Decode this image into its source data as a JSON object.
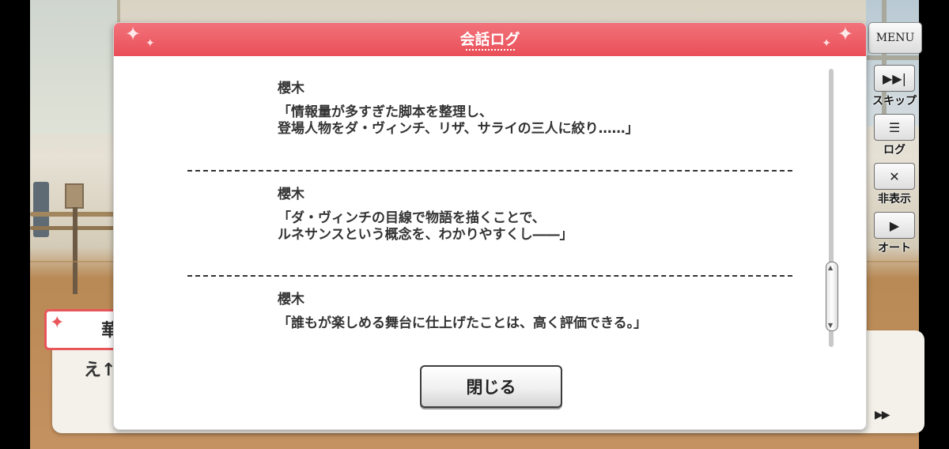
{
  "dialog": {
    "title": "会話ログ",
    "entries": [
      {
        "speaker": "櫻木",
        "lines": [
          "「情報量が多すぎた脚本を整理し、",
          "登場人物をダ・ヴィンチ、リザ、サライの三人に絞り……」"
        ]
      },
      {
        "speaker": "櫻木",
        "lines": [
          "「ダ・ヴィンチの目線で物語を描くことで、",
          "ルネサンスという概念を、わかりやすくし――」"
        ]
      },
      {
        "speaker": "櫻木",
        "lines": [
          "「誰もが楽しめる舞台に仕上げたことは、高く評価できる。」"
        ]
      }
    ],
    "close_label": "閉じる"
  },
  "side_menu": {
    "menu_label": "MENU",
    "buttons": [
      {
        "label": "スキップ",
        "icon": "skip-icon",
        "glyph": "▶▶|"
      },
      {
        "label": "ログ",
        "icon": "log-icon",
        "glyph": "☰"
      },
      {
        "label": "非表示",
        "icon": "hide-icon",
        "glyph": "✕"
      },
      {
        "label": "オート",
        "icon": "auto-play-icon",
        "glyph": "▶"
      }
    ]
  },
  "message_window": {
    "speaker_partial": "華",
    "text_partial": "え↑",
    "advance_glyph": "▶▶"
  },
  "colors": {
    "header_red": "#e94f58",
    "accent": "#e8565a"
  }
}
